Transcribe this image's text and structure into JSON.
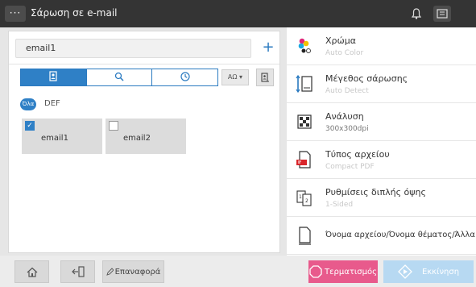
{
  "header": {
    "menu_label": "···",
    "title": "Σάρωση σε e-mail"
  },
  "destination": {
    "value": "email1",
    "add_label": "+"
  },
  "addressbook": {
    "sort_label": "ΑΩ ▾",
    "index": {
      "badge": "Όλα",
      "label": "DEF"
    },
    "entries": [
      {
        "name": "email1",
        "checked": true
      },
      {
        "name": "email2",
        "checked": false
      }
    ]
  },
  "settings": [
    {
      "name": "Χρώμα",
      "value": "Auto Color",
      "icon": "color-icon"
    },
    {
      "name": "Μέγεθος σάρωσης",
      "value": "Auto Detect",
      "icon": "scan-size-icon"
    },
    {
      "name": "Ανάλυση",
      "value": "300x300dpi",
      "icon": "resolution-icon"
    },
    {
      "name": "Τύπος αρχείου",
      "value": "Compact PDF",
      "icon": "file-type-icon"
    },
    {
      "name": "Ρυθμίσεις διπλής όψης",
      "value": "1-Sided",
      "icon": "duplex-icon"
    },
    {
      "name": "Όνομα αρχείου/Όνομα θέματος/Άλλα",
      "value": "",
      "icon": "file-name-icon"
    }
  ],
  "footer": {
    "reset_label": "Επαναφορά",
    "stop_label": "Τερματισμός",
    "start_label": "Εκκίνηση"
  },
  "colors": {
    "accent": "#2f80c6",
    "stop": "#e85a8c",
    "start": "#b7d9f2",
    "titlebar": "#343434"
  }
}
